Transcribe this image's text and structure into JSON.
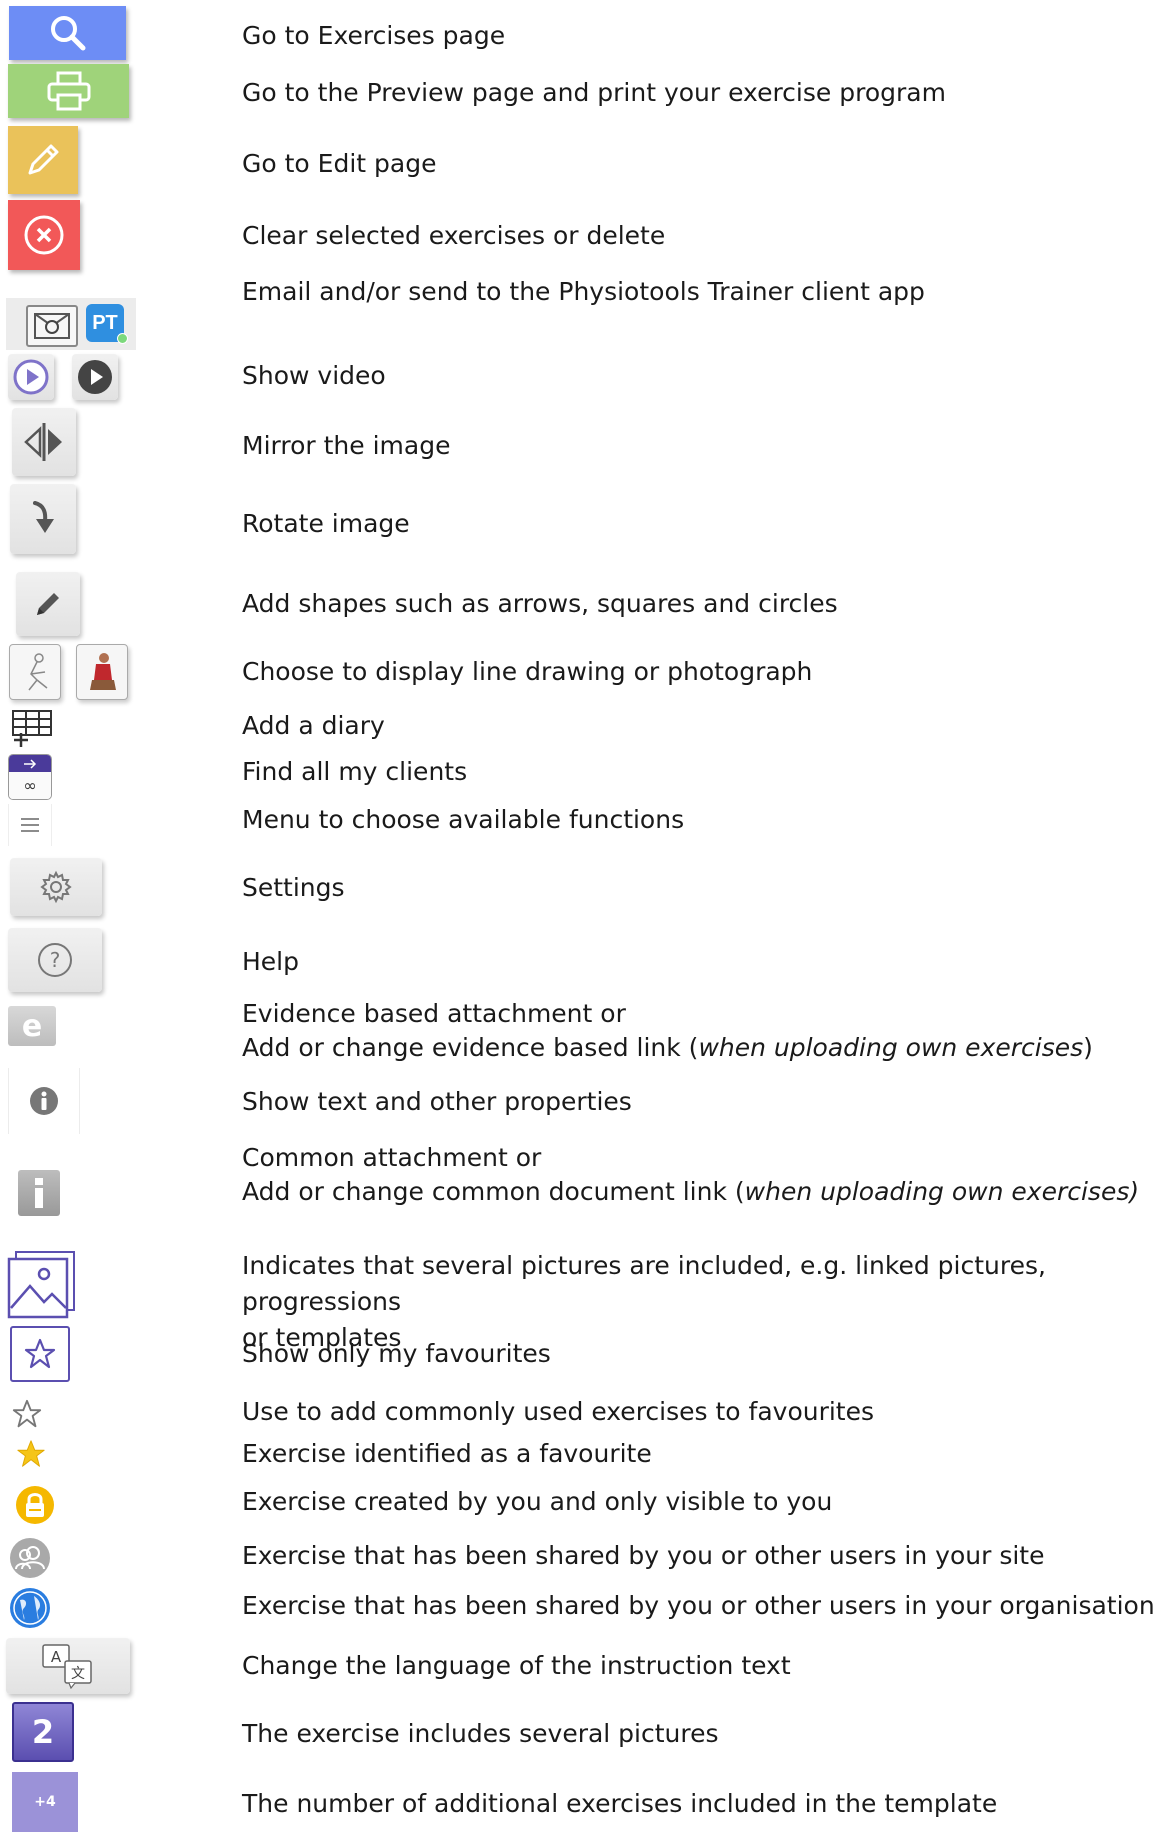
{
  "items": [
    {
      "icon": "search-icon",
      "text": "Go to Exercises page"
    },
    {
      "icon": "printer-icon",
      "text": "Go to the Preview page and print your exercise program"
    },
    {
      "icon": "pencil-icon",
      "text": "Go to Edit page"
    },
    {
      "icon": "close-circle-icon",
      "text": "Clear selected exercises or delete"
    },
    {
      "icon": "email-pt-icons",
      "text": "Email and/or send to the Physiotools Trainer client app",
      "badge": "PT"
    },
    {
      "icon": "play-video-icons",
      "text": "Show video"
    },
    {
      "icon": "mirror-icon",
      "text": "Mirror the image"
    },
    {
      "icon": "rotate-arrow-icon",
      "text": "Rotate image"
    },
    {
      "icon": "draw-pencil-icon",
      "text": "Add shapes such as arrows, squares and circles"
    },
    {
      "icon": "drawing-photo-icons",
      "text": "Choose to display line drawing or photograph"
    },
    {
      "icon": "diary-table-icon",
      "text": "Add a diary"
    },
    {
      "icon": "clients-icon",
      "text": "Find all my clients",
      "badge": "∞"
    },
    {
      "icon": "hamburger-menu-icon",
      "text": "Menu to choose available functions"
    },
    {
      "icon": "gear-icon",
      "text": "Settings"
    },
    {
      "icon": "help-circle-icon",
      "text": "Help"
    },
    {
      "icon": "evidence-e-icon",
      "badge": "e",
      "line1": "Evidence based attachment or",
      "line2_prefix": "Add or change evidence based link (",
      "line2_italic": "when uploading own exercises",
      "line2_suffix": ")"
    },
    {
      "icon": "info-circle-icon",
      "text": "Show text and other properties"
    },
    {
      "icon": "info-square-icon",
      "line1": "Common attachment or",
      "line2_prefix": "Add or change common document link (",
      "line2_italic": "when uploading own exercises)",
      "line2_suffix": ""
    },
    {
      "icon": "pictures-stack-icon",
      "line1": "Indicates that several pictures are included, e.g. linked pictures, progressions",
      "line2": "or templates"
    },
    {
      "icon": "star-box-icon",
      "text": "Show only my favourites"
    },
    {
      "icon": "star-outline-icon",
      "text": "Use to add commonly used exercises to favourites"
    },
    {
      "icon": "star-filled-icon",
      "text": "Exercise identified as a favourite"
    },
    {
      "icon": "lock-icon",
      "text": "Exercise created by you and only visible to you"
    },
    {
      "icon": "users-icon",
      "text": "Exercise that has been shared by you or other users in your site"
    },
    {
      "icon": "globe-icon",
      "text": "Exercise that has been shared by you or other users in your organisation"
    },
    {
      "icon": "translate-icon",
      "text": "Change the language of the instruction text"
    },
    {
      "icon": "picture-count-icon",
      "text": "The exercise includes several pictures",
      "badge": "2"
    },
    {
      "icon": "template-count-icon",
      "text": "The number of additional exercises included in the template",
      "badge": "+4"
    }
  ],
  "colors": {
    "search": "#6d8df5",
    "print": "#9fd37a",
    "edit": "#eac25a",
    "delete": "#f25858",
    "pt_blue": "#2f8fe0",
    "purple": "#5b4fb0",
    "star": "#f5c518",
    "lock": "#f5b800",
    "globe": "#2a7de0"
  }
}
